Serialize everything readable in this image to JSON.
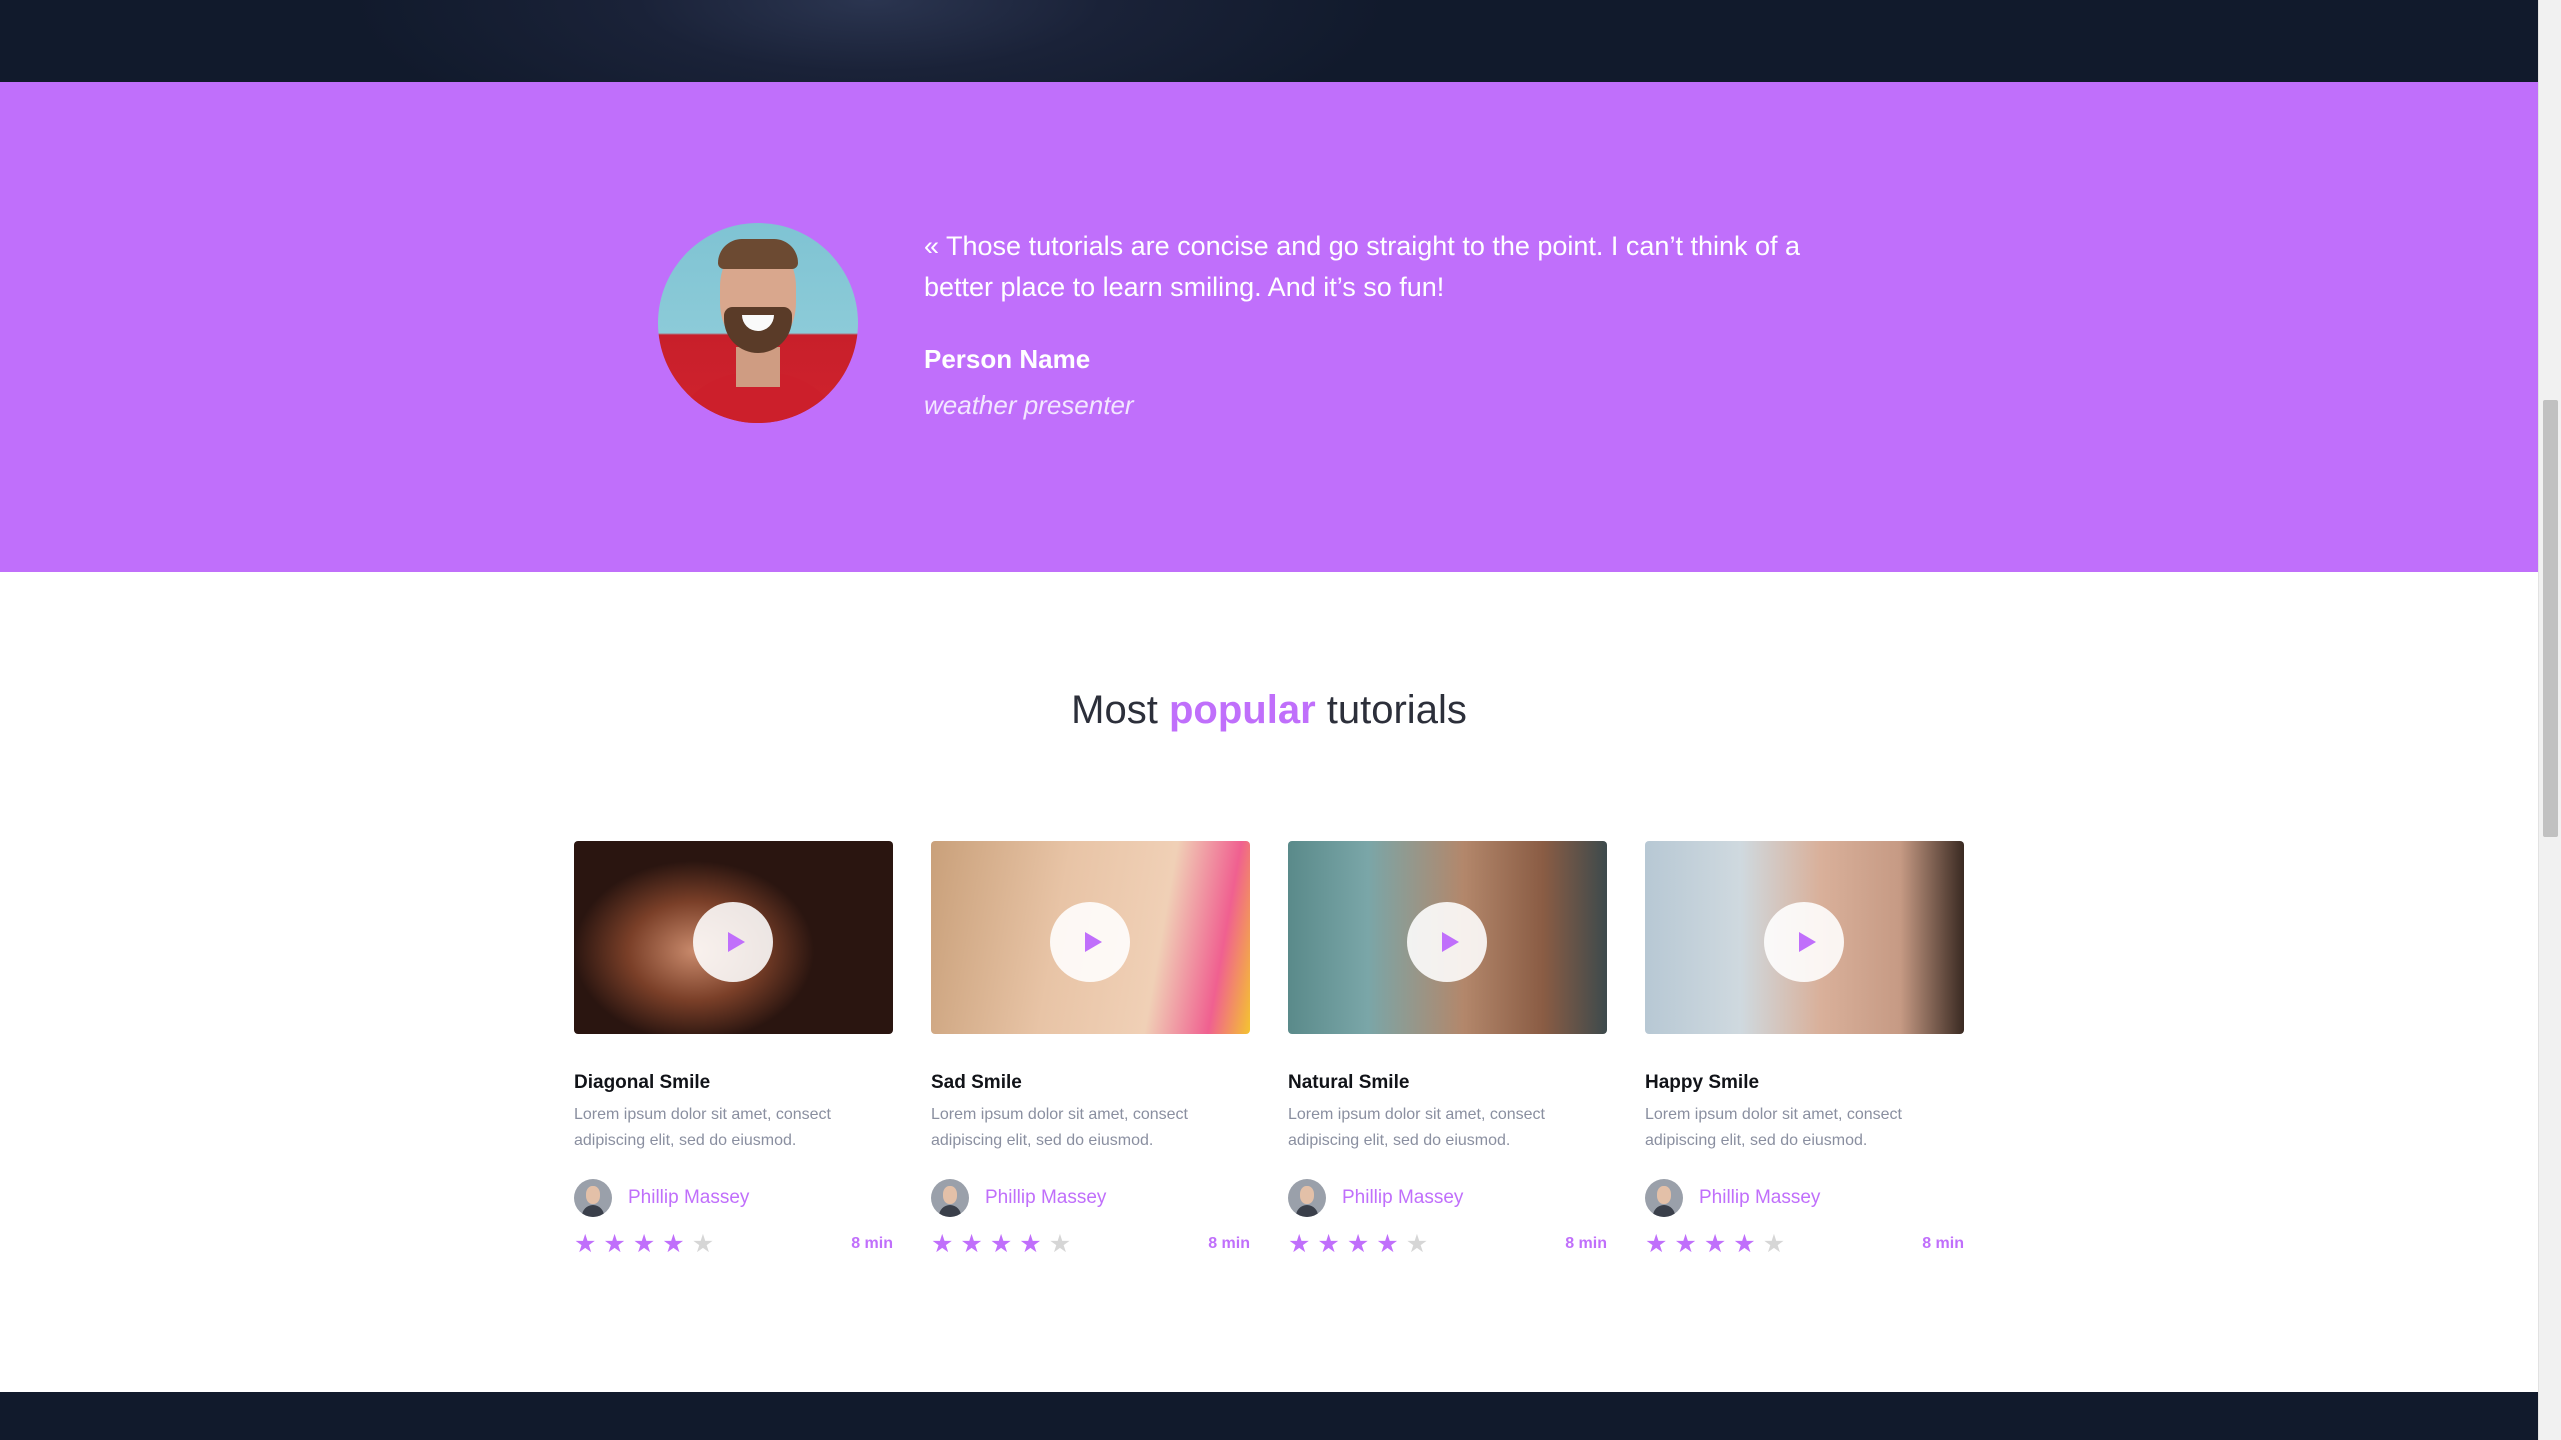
{
  "testimonial": {
    "quote": "« Those tutorials are concise and go straight to the point. I can’t think of a better place to learn smiling. And it’s so fun!",
    "person_name": "Person Name",
    "person_role": "weather presenter"
  },
  "section": {
    "title_before": "Most",
    "title_accent": "popular",
    "title_after": "tutorials"
  },
  "cards": [
    {
      "title": "Diagonal Smile",
      "description": "Lorem ipsum dolor sit amet, consect adipiscing elit, sed do eiusmod.",
      "author": "Phillip Massey",
      "rating": 4,
      "rating_max": 5,
      "duration": "8 min"
    },
    {
      "title": "Sad Smile",
      "description": "Lorem ipsum dolor sit amet, consect adipiscing elit, sed do eiusmod.",
      "author": "Phillip Massey",
      "rating": 4,
      "rating_max": 5,
      "duration": "8 min"
    },
    {
      "title": "Natural Smile",
      "description": "Lorem ipsum dolor sit amet, consect adipiscing elit, sed do eiusmod.",
      "author": "Phillip Massey",
      "rating": 4,
      "rating_max": 5,
      "duration": "8 min"
    },
    {
      "title": "Happy Smile",
      "description": "Lorem ipsum dolor sit amet, consect adipiscing elit, sed do eiusmod.",
      "author": "Phillip Massey",
      "rating": 4,
      "rating_max": 5,
      "duration": "8 min"
    }
  ],
  "icons": {
    "play": "play-icon",
    "star": "star-icon"
  },
  "colors": {
    "accent": "#c06ffb",
    "dark_navy": "#111a2c",
    "muted_text": "#8a8fa0",
    "star_off": "#d6d6d6"
  }
}
